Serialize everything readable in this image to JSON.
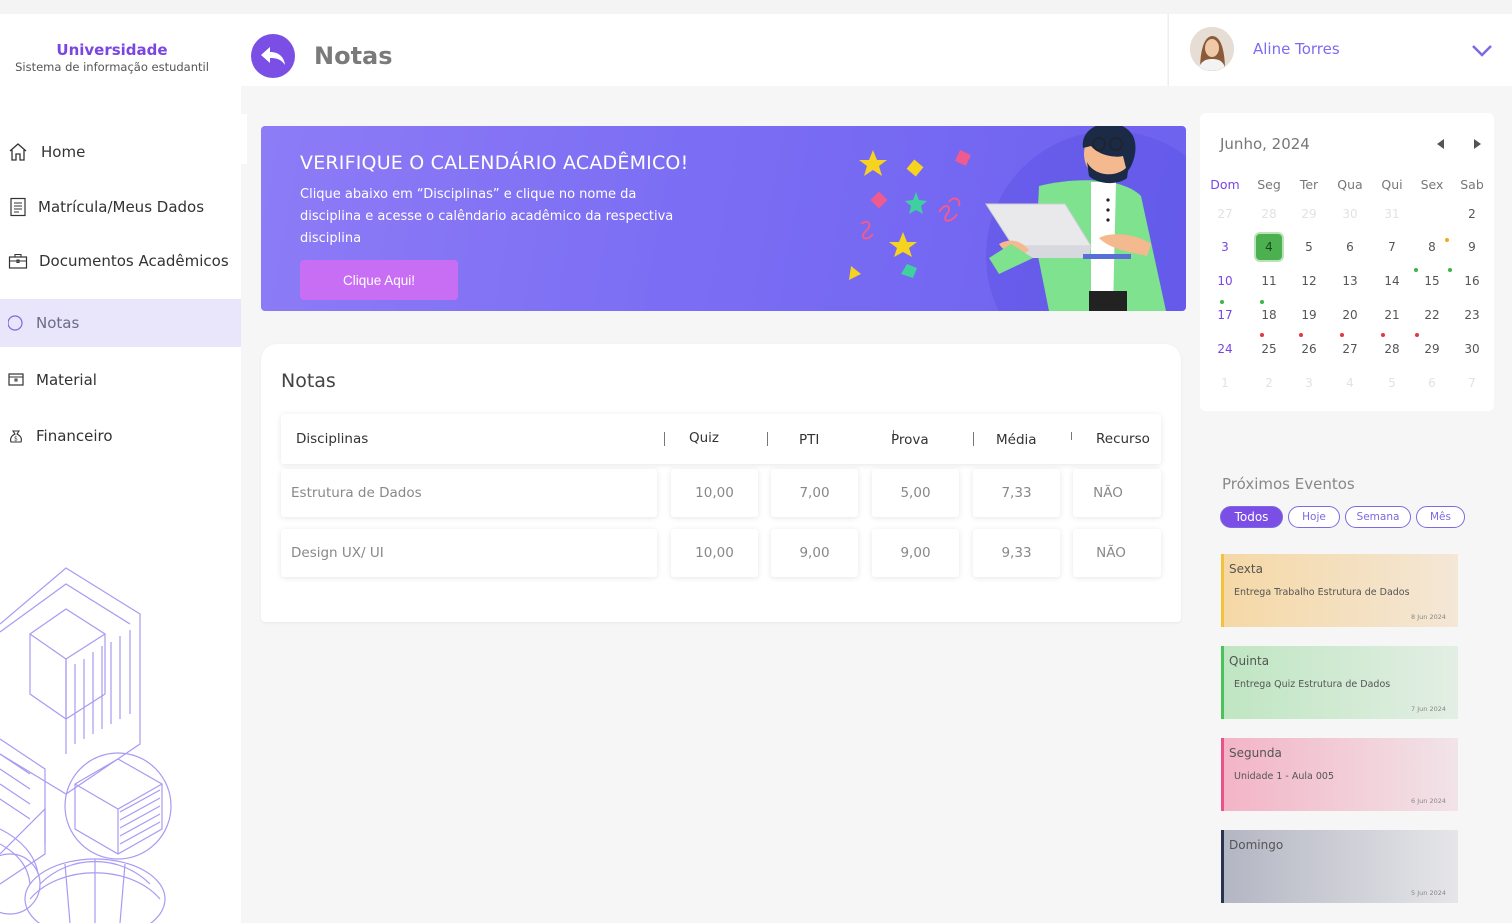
{
  "brand": {
    "title": "Universidade",
    "subtitle": "Sistema de informação estudantil"
  },
  "nav": [
    {
      "label": "Home",
      "icon": "home-icon"
    },
    {
      "label": "Matrícula/Meus Dados",
      "icon": "document-icon"
    },
    {
      "label": "Documentos Acadêmicos",
      "icon": "briefcase-icon"
    },
    {
      "label": "Notas",
      "icon": "circle-icon",
      "active": true
    },
    {
      "label": "Material",
      "icon": "folder-icon"
    },
    {
      "label": "Financeiro",
      "icon": "money-bag-icon"
    }
  ],
  "header": {
    "title": "Notas",
    "back_icon": "back-arrow-icon"
  },
  "user": {
    "name": "Aline Torres",
    "menu_icon": "chevron-down-icon"
  },
  "banner": {
    "title": "VERIFIQUE O CALENDÁRIO ACADÊMICO!",
    "text": "Clique abaixo em “Disciplinas” e clique no nome da disciplina e acesse o calêndario acadêmico da respectiva disciplina",
    "button": "Clique Aqui!"
  },
  "grades": {
    "title": "Notas",
    "columns": [
      "Disciplinas",
      "Quiz",
      "PTI",
      "Prova",
      "Média",
      "Recurso"
    ],
    "rows": [
      [
        "Estrutura de Dados",
        "10,00",
        "7,00",
        "5,00",
        "7,33",
        "NÃO"
      ],
      [
        "Design UX/ UI",
        "10,00",
        "9,00",
        "9,00",
        "9,33",
        "NÃO"
      ]
    ]
  },
  "calendar": {
    "title": "Junho, 2024",
    "weekdays": [
      "Dom",
      "Seg",
      "Ter",
      "Qua",
      "Qui",
      "Sex",
      "Sab"
    ],
    "weeks": [
      [
        "27",
        "28",
        "29",
        "30",
        "31",
        "",
        "2"
      ],
      [
        "3",
        "4",
        "5",
        "6",
        "7",
        "8",
        "9"
      ],
      [
        "10",
        "11",
        "12",
        "13",
        "14",
        "15",
        "16"
      ],
      [
        "17",
        "18",
        "19",
        "20",
        "21",
        "22",
        "23"
      ],
      [
        "24",
        "25",
        "26",
        "27",
        "28",
        "29",
        "30"
      ],
      [
        "1",
        "2",
        "3",
        "4",
        "5",
        "6",
        "7"
      ]
    ],
    "today": "4",
    "colors": {
      "accent": "#7b45e3",
      "today": "#4caf50",
      "dot_green": "#3cb44b",
      "dot_red": "#e0393e",
      "dot_orange": "#f5a623"
    }
  },
  "events": {
    "title": "Próximos Eventos",
    "filters": [
      "Todos",
      "Hoje",
      "Semana",
      "Mês"
    ],
    "active_filter": "Todos",
    "items": [
      {
        "day": "Sexta",
        "desc": "Entrega Trabalho Estrutura de Dados",
        "date": "8 Jun 2024",
        "color": "#f2c33a"
      },
      {
        "day": "Quinta",
        "desc": "Entrega Quiz Estrutura de Dados",
        "date": "7 Jun  2024",
        "color": "#4cc25a"
      },
      {
        "day": "Segunda",
        "desc": "Unidade 1 -  Aula 005",
        "date": "6 Jun 2024",
        "color": "#e8548a"
      },
      {
        "day": "Domingo",
        "desc": "",
        "date": "5 Jun 2024",
        "color": "#2a3450"
      }
    ]
  }
}
